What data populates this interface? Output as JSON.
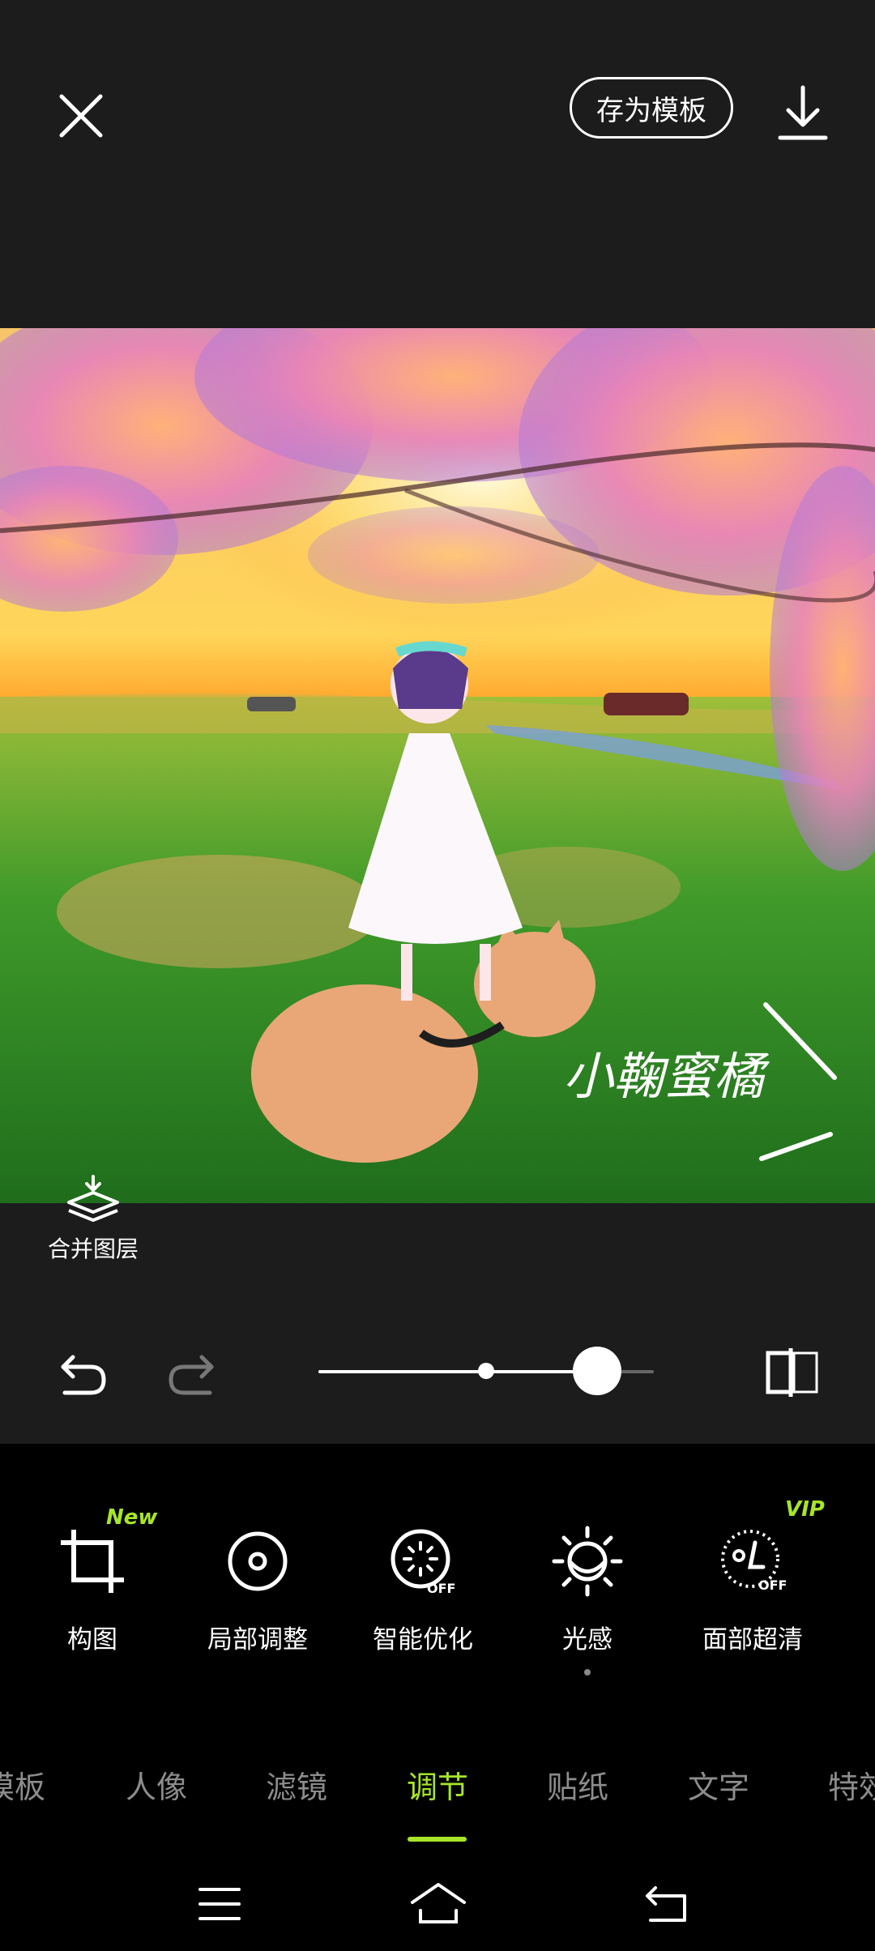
{
  "header": {
    "save_template_label": "存为模板",
    "close_icon": "close-icon",
    "download_icon": "download-icon"
  },
  "photo": {
    "signature_text": "小鞠蜜橘"
  },
  "merge_layer": {
    "label": "合并图层",
    "icon": "layers-icon"
  },
  "controls": {
    "undo_icon": "undo-icon",
    "redo_icon": "redo-icon",
    "slider_default_fraction": 0.5,
    "slider_value_fraction": 0.83,
    "compare_icon": "compare-icon"
  },
  "tools": [
    {
      "label": "构图",
      "icon": "crop-icon",
      "badge": "New"
    },
    {
      "label": "局部调整",
      "icon": "local-adjust-icon",
      "badge": ""
    },
    {
      "label": "智能优化",
      "icon": "smart-optimize-icon",
      "badge": "",
      "sub": "OFF"
    },
    {
      "label": "光感",
      "icon": "light-icon",
      "badge": ""
    },
    {
      "label": "面部超清",
      "icon": "face-hd-icon",
      "badge": "VIP",
      "sub": "OFF"
    }
  ],
  "tabs": [
    {
      "label": "模板",
      "active": false
    },
    {
      "label": "人像",
      "active": false
    },
    {
      "label": "滤镜",
      "active": false
    },
    {
      "label": "调节",
      "active": true
    },
    {
      "label": "贴纸",
      "active": false
    },
    {
      "label": "文字",
      "active": false
    },
    {
      "label": "特效",
      "active": false
    }
  ],
  "colors": {
    "accent": "#a6e52a",
    "background": "#1c1c1d",
    "panel": "#000000"
  },
  "navbar": {
    "menu_icon": "menu-icon",
    "home_icon": "home-icon",
    "back_icon": "back-icon"
  }
}
